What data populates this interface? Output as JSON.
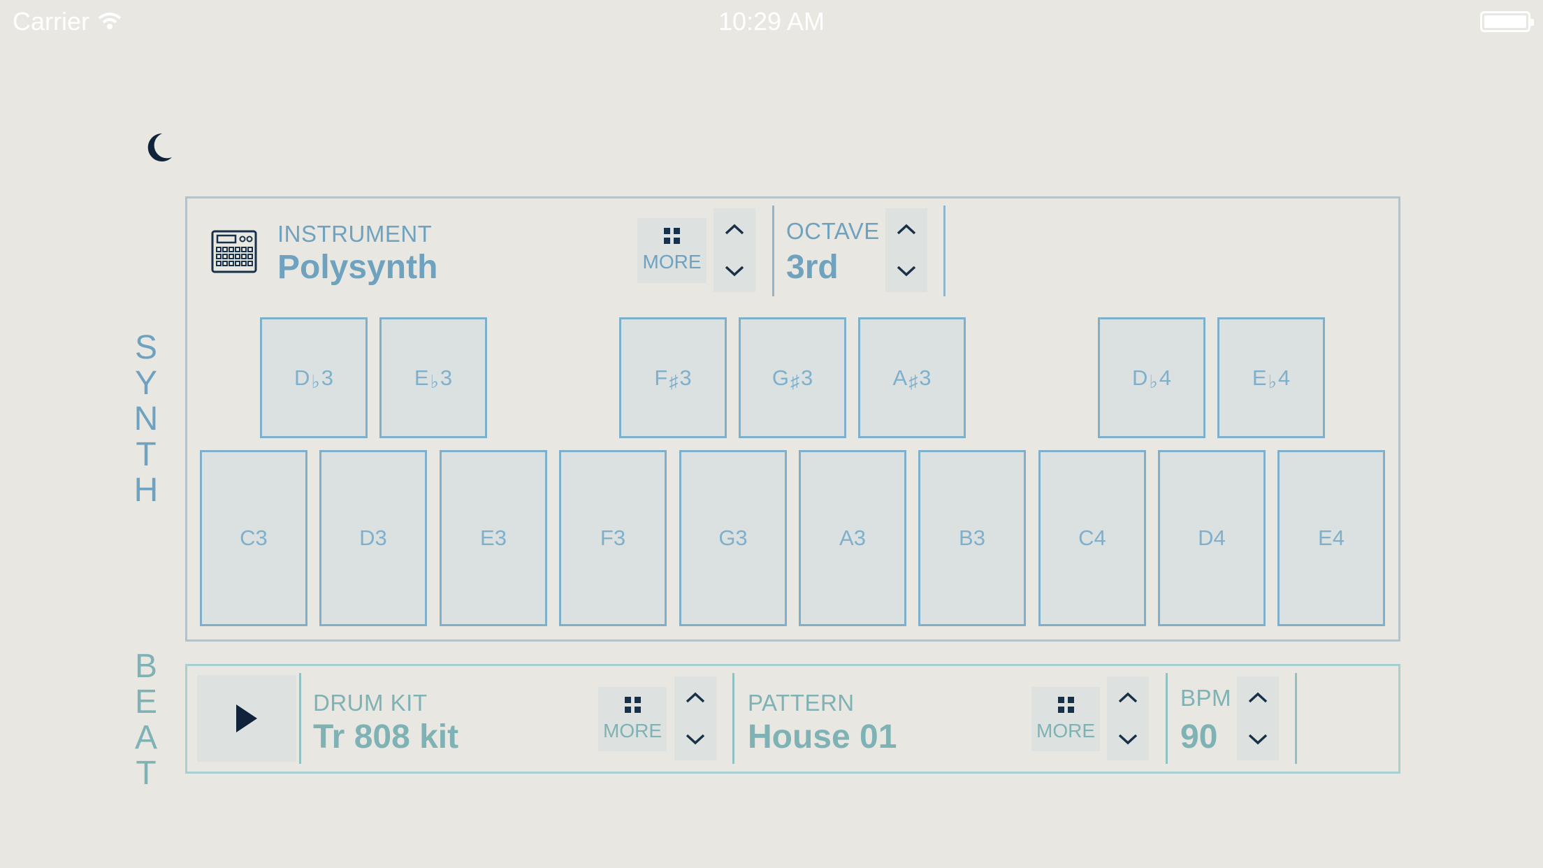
{
  "status_bar": {
    "carrier": "Carrier",
    "time": "10:29 AM"
  },
  "synth": {
    "section_label": [
      "S",
      "Y",
      "N",
      "T",
      "H"
    ],
    "instrument_label": "INSTRUMENT",
    "instrument_value": "Polysynth",
    "more_label": "MORE",
    "octave_label": "OCTAVE",
    "octave_value": "3rd",
    "black_keys": [
      {
        "note": "D",
        "acc": "♭",
        "oct": "3"
      },
      {
        "note": "E",
        "acc": "♭",
        "oct": "3"
      },
      {
        "note": "F",
        "acc": "♯",
        "oct": "3"
      },
      {
        "note": "G",
        "acc": "♯",
        "oct": "3"
      },
      {
        "note": "A",
        "acc": "♯",
        "oct": "3"
      },
      {
        "note": "D",
        "acc": "♭",
        "oct": "4"
      },
      {
        "note": "E",
        "acc": "♭",
        "oct": "4"
      }
    ],
    "white_keys": [
      "C3",
      "D3",
      "E3",
      "F3",
      "G3",
      "A3",
      "B3",
      "C4",
      "D4",
      "E4"
    ]
  },
  "beat": {
    "section_label": [
      "B",
      "E",
      "A",
      "T"
    ],
    "drum_kit_label": "DRUM KIT",
    "drum_kit_value": "Tr 808 kit",
    "drum_more_label": "MORE",
    "pattern_label": "PATTERN",
    "pattern_value": "House 01",
    "pattern_more_label": "MORE",
    "bpm_label": "BPM",
    "bpm_value": "90"
  },
  "icons": {
    "moon": "moon-icon",
    "instrument": "drum-machine-icon",
    "play": "play-icon",
    "more": "grid-icon",
    "up": "chevron-up-icon",
    "down": "chevron-down-icon"
  },
  "colors": {
    "background": "#e8e7e2",
    "synth_accent": "#6fa2bf",
    "beat_accent": "#7fb2b4",
    "dark": "#183048"
  }
}
